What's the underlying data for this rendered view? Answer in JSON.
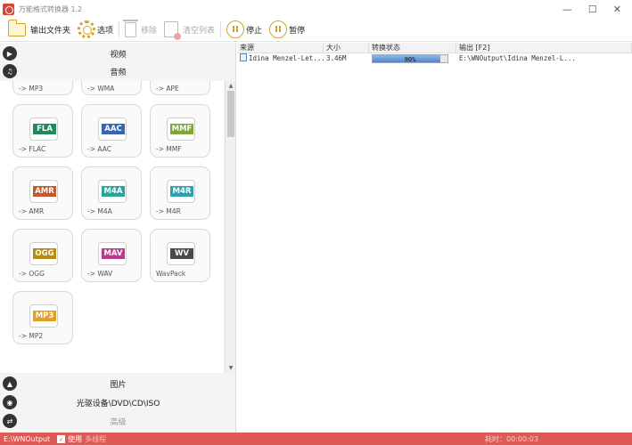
{
  "window": {
    "title": "万能格式转换器 1.2",
    "minimize": "—",
    "maximize": "☐",
    "close": "✕"
  },
  "toolbar": {
    "output_folder": "输出文件夹",
    "options": "选项",
    "remove": "移除",
    "clear_list": "清空列表",
    "stop": "停止",
    "pause": "暂停"
  },
  "categories": {
    "video": "视频",
    "audio": "音频",
    "image": "图片",
    "optical": "光驱设备\\DVD\\CD\\ISO",
    "advanced": "高级"
  },
  "formats_partial": [
    "-> MP3",
    "-> WMA",
    "-> APE"
  ],
  "formats": [
    {
      "badge": "FLA",
      "label": "-> FLAC",
      "color": "#1f8a5b"
    },
    {
      "badge": "AAC",
      "label": "-> AAC",
      "color": "#3367b5"
    },
    {
      "badge": "MMF",
      "label": "-> MMF",
      "color": "#7ea43a"
    },
    {
      "badge": "AMR",
      "label": "-> AMR",
      "color": "#c4572d"
    },
    {
      "badge": "M4A",
      "label": "-> M4A",
      "color": "#2aa39a"
    },
    {
      "badge": "M4R",
      "label": "-> M4R",
      "color": "#2aa3b0"
    },
    {
      "badge": "OGG",
      "label": "-> OGG",
      "color": "#b88a14"
    },
    {
      "badge": "MAV",
      "label": "-> WAV",
      "color": "#b83a8f"
    },
    {
      "badge": "WV",
      "label": "WavPack",
      "color": "#4a4a4a"
    },
    {
      "badge": "MP3",
      "label": "-> MP2",
      "color": "#e2a020"
    }
  ],
  "table": {
    "headers": {
      "source": "来源",
      "size": "大小",
      "status": "转换状态",
      "output": "输出 [F2]"
    },
    "rows": [
      {
        "source": "Idina Menzel-Let...",
        "size": "3.46M",
        "progress": 90,
        "progress_text": "90%",
        "output": "E:\\WNOutput\\Idina Menzel-L..."
      }
    ]
  },
  "status": {
    "output_path": "E:\\WNOutput",
    "use_label": "使用",
    "multithread": "多线程",
    "time_label": "耗时：00:00:03"
  },
  "colors": {
    "accent": "#de5a55",
    "icon_gold": "#d4a326"
  }
}
